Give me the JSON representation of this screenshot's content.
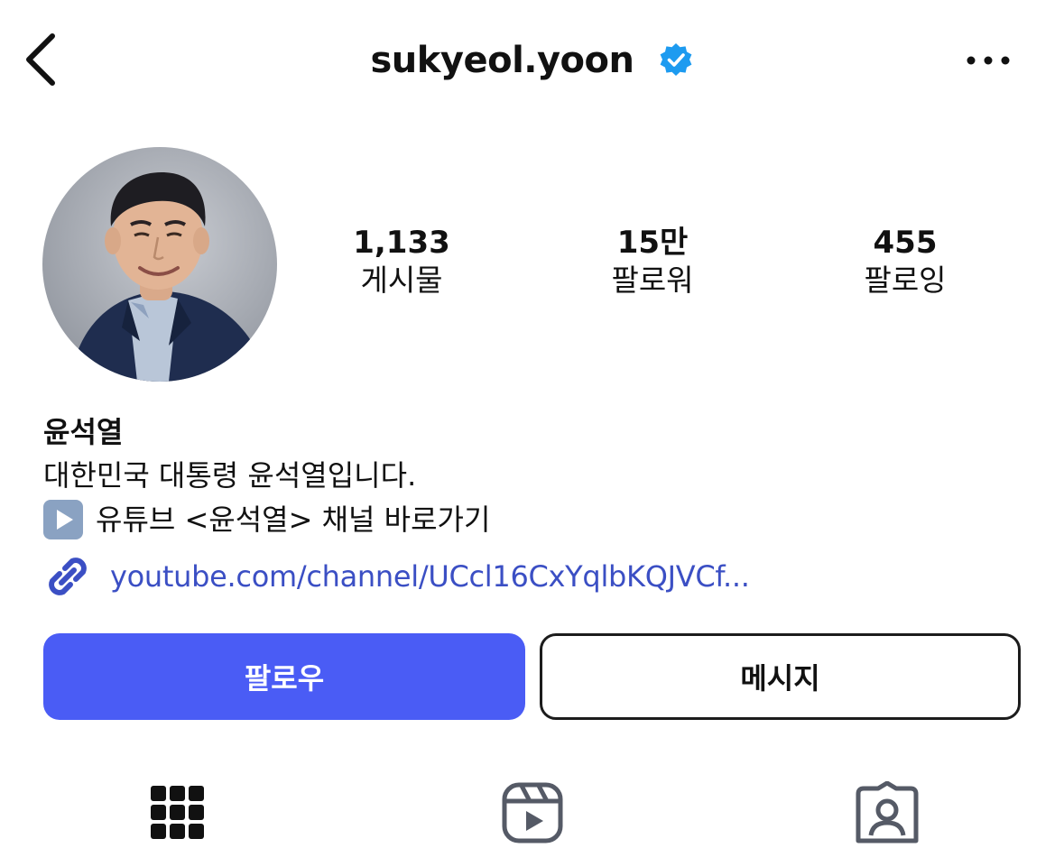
{
  "header": {
    "username": "sukyeol.yoon",
    "verified": true,
    "back_icon": "chevron-left-icon",
    "more_icon": "more-horizontal-icon"
  },
  "profile": {
    "avatar_icon": "profile-photo",
    "stats": [
      {
        "value": "1,133",
        "label": "게시물"
      },
      {
        "value": "15만",
        "label": "팔로워"
      },
      {
        "value": "455",
        "label": "팔로잉"
      }
    ],
    "display_name": "윤석열",
    "bio_lines": [
      "대한민국 대통령 윤석열입니다.",
      "유튜브 <윤석열> 채널 바로가기"
    ],
    "link": "youtube.com/channel/UCcl16CxYqlbKQJVCf..."
  },
  "actions": {
    "follow_label": "팔로우",
    "message_label": "메시지"
  },
  "tabs": [
    {
      "icon": "grid-icon"
    },
    {
      "icon": "reels-icon"
    },
    {
      "icon": "tagged-icon"
    }
  ],
  "colors": {
    "follow_button": "#4a5cf5",
    "link": "#3b4fc4",
    "verified_badge": "#1d9bf0"
  }
}
